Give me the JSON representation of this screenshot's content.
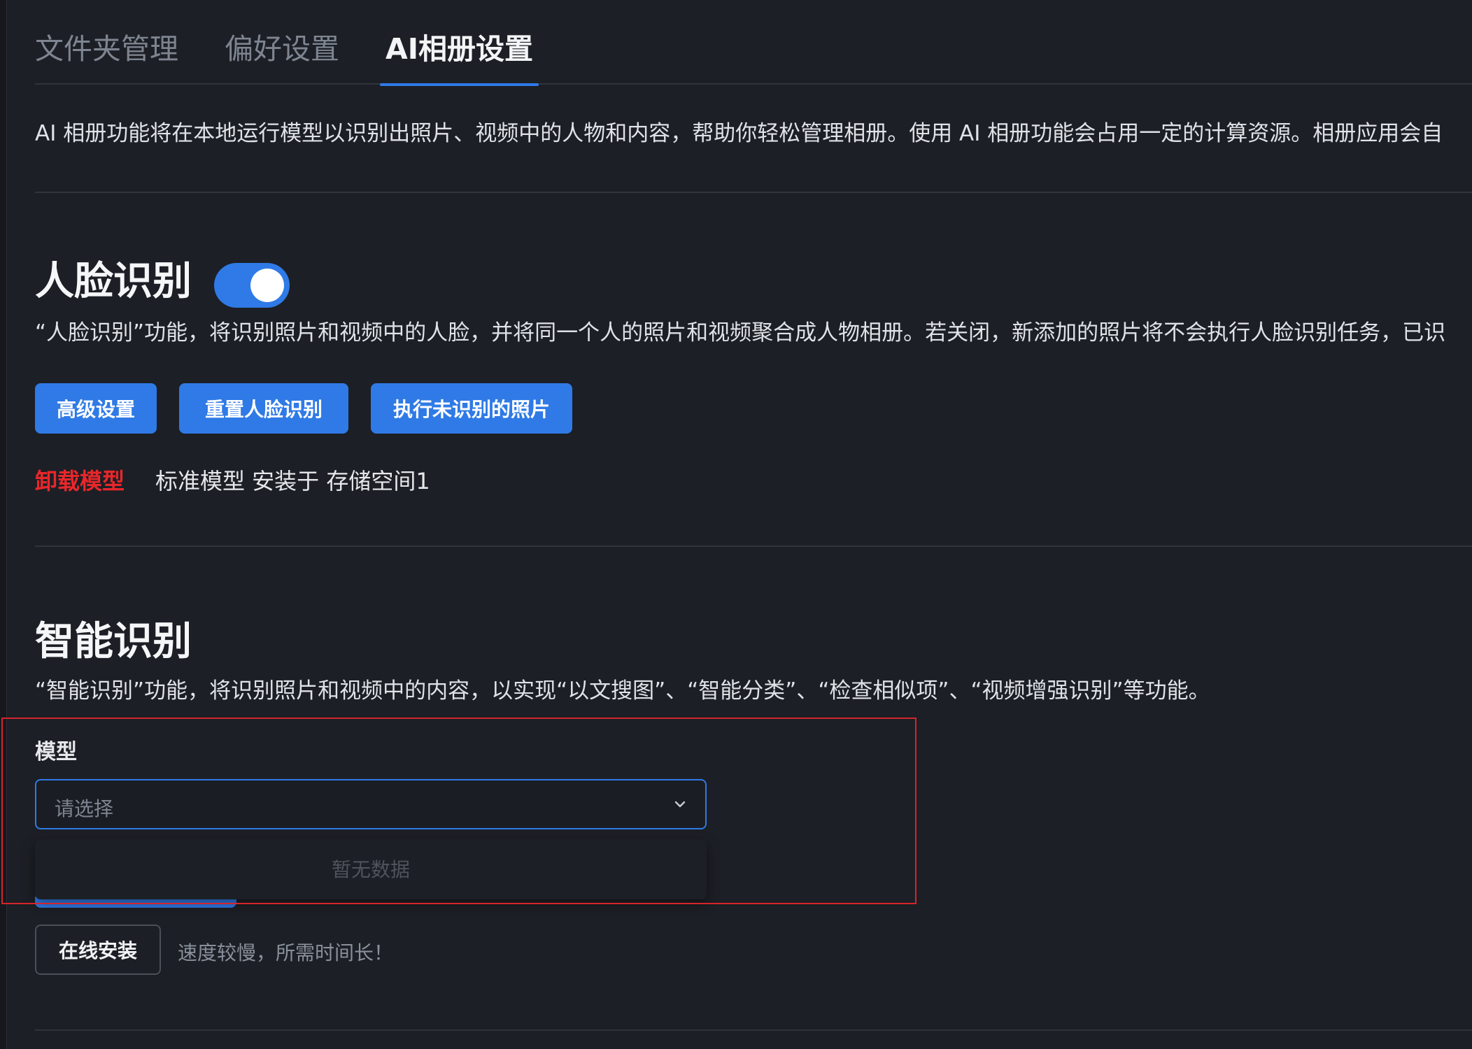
{
  "tabs": [
    {
      "label": "文件夹管理",
      "active": false
    },
    {
      "label": "偏好设置",
      "active": false
    },
    {
      "label": "AI相册设置",
      "active": true
    }
  ],
  "intro": "AI 相册功能将在本地运行模型以识别出照片、视频中的人物和内容，帮助你轻松管理相册。使用 AI 相册功能会占用一定的计算资源。相册应用会自",
  "face": {
    "title": "人脸识别",
    "enabled": true,
    "description": "“人脸识别”功能，将识别照片和视频中的人脸，并将同一个人的照片和视频聚合成人物相册。若关闭，新添加的照片将不会执行人脸识别任务，已识",
    "buttons": {
      "advanced": "高级设置",
      "reset": "重置人脸识别",
      "run_unrecognized": "执行未识别的照片"
    },
    "uninstall": "卸载模型",
    "model_info": "标准模型 安装于 存储空间1"
  },
  "smart": {
    "title": "智能识别",
    "description": "“智能识别”功能，将识别照片和视频中的内容，以实现“以文搜图”、“智能分类”、“检查相似项”、“视频增强识别”等功能。",
    "model_label": "模型",
    "select_placeholder": "请选择",
    "dropdown_empty": "暂无数据",
    "install_button": "在线安装",
    "install_hint": "速度较慢，所需时间长！"
  },
  "colors": {
    "accent": "#2f7ae6",
    "danger": "#e8272b",
    "background": "#1c1f25"
  }
}
